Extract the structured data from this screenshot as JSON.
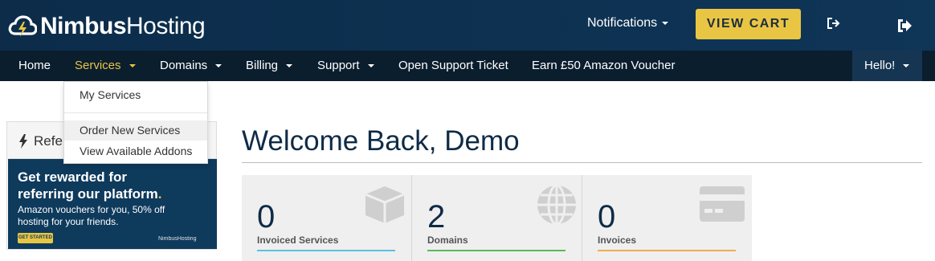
{
  "header": {
    "brand_bold": "Nimbus",
    "brand_regular": "Hosting",
    "notifications_label": "Notifications",
    "view_cart_label": "VIEW CART"
  },
  "nav": {
    "items": [
      {
        "label": "Home"
      },
      {
        "label": "Services"
      },
      {
        "label": "Domains"
      },
      {
        "label": "Billing"
      },
      {
        "label": "Support"
      },
      {
        "label": "Open Support Ticket"
      },
      {
        "label": "Earn £50 Amazon Voucher"
      }
    ],
    "hello_label": "Hello!"
  },
  "services_menu": {
    "items": [
      {
        "label": "My Services"
      },
      {
        "label": "Order New Services"
      },
      {
        "label": "View Available Addons"
      }
    ]
  },
  "referral_panel": {
    "title": "Refer",
    "headline": "Get rewarded for referring our platform",
    "headline_dot": ".",
    "subtext": "Amazon vouchers for you, 50% off hosting for your friends.",
    "cta": "GET STARTED",
    "banner_logo": "NimbusHosting"
  },
  "main": {
    "welcome": "Welcome Back, Demo",
    "stats": [
      {
        "value": "0",
        "label": "Invoiced Services",
        "color": "#5bc0de",
        "icon": "box-icon"
      },
      {
        "value": "2",
        "label": "Domains",
        "color": "#5cb85c",
        "icon": "globe-icon"
      },
      {
        "value": "0",
        "label": "Invoices",
        "color": "#f0ad4e",
        "icon": "credit-card-icon"
      }
    ]
  },
  "colors": {
    "header_bg": "#0c2c4a",
    "nav_bg": "#0b1e2e",
    "accent": "#e9c544"
  }
}
